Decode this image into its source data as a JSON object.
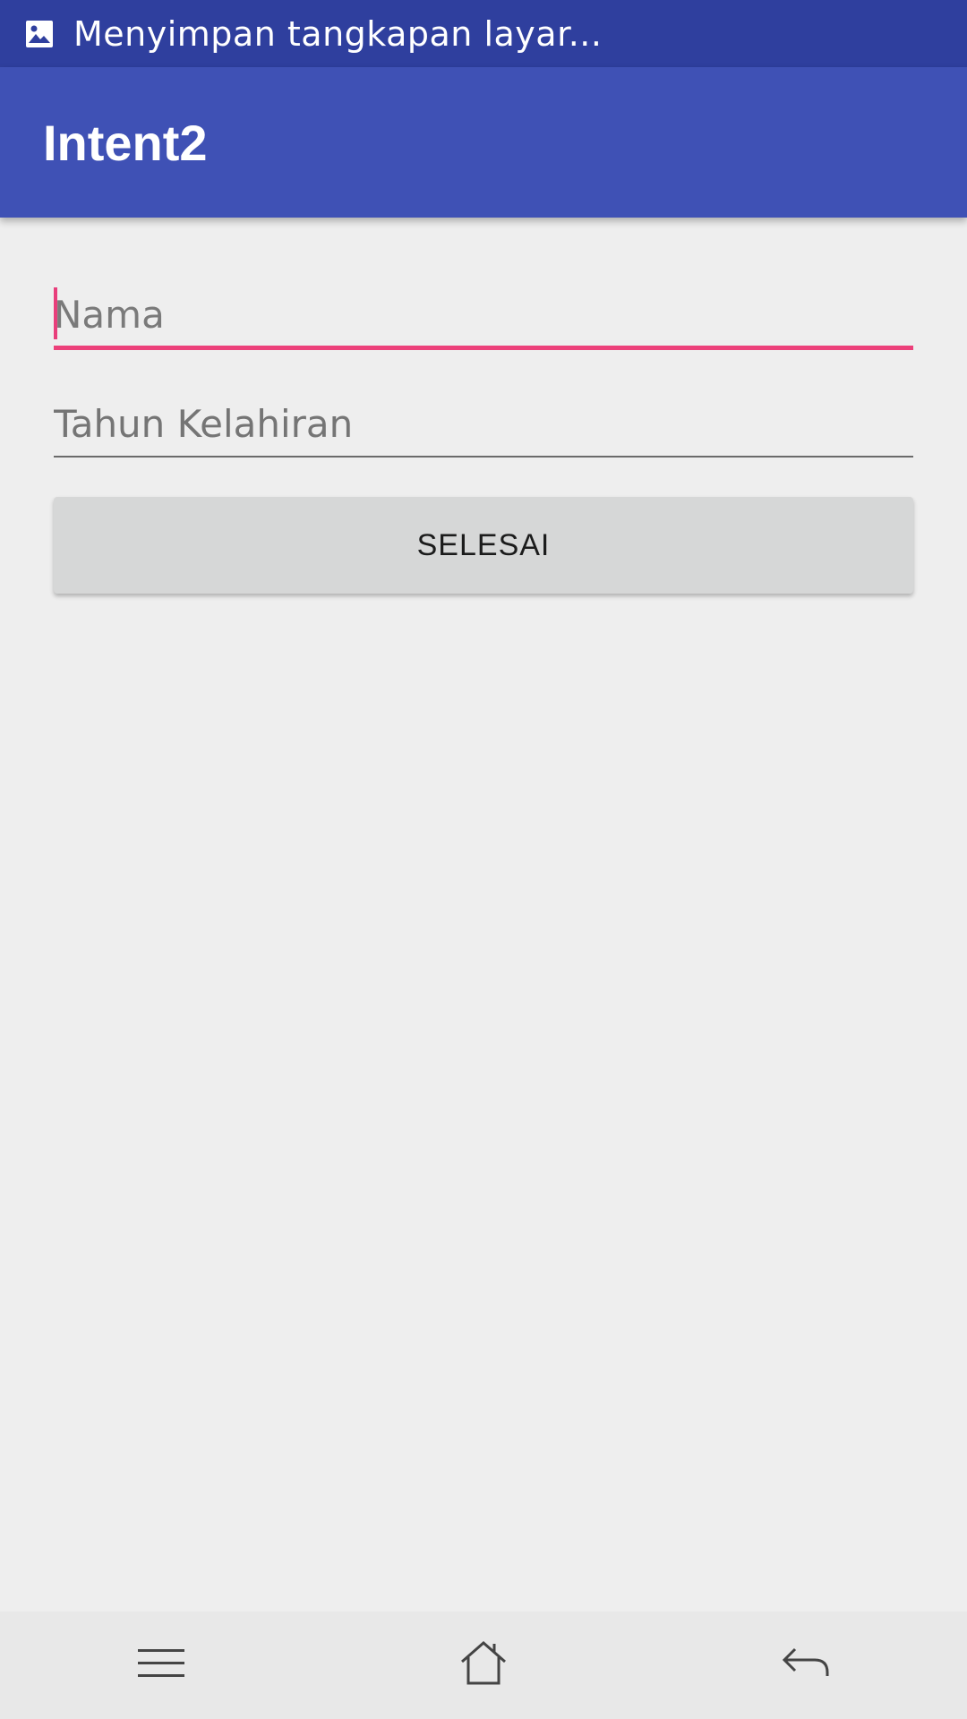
{
  "status_bar": {
    "notification_icon": "image-icon",
    "text": "Menyimpan tangkapan layar..."
  },
  "app_bar": {
    "title": "Intent2"
  },
  "form": {
    "name_placeholder": "Nama",
    "name_value": "",
    "year_placeholder": "Tahun Kelahiran",
    "year_value": "",
    "submit_label": "SELESAI"
  },
  "nav_bar": {
    "menu_icon": "menu-icon",
    "home_icon": "home-icon",
    "back_icon": "back-icon"
  },
  "colors": {
    "status_bar": "#2f3f9e",
    "app_bar": "#3f51b5",
    "accent": "#ec407a",
    "background": "#eeeeee",
    "button": "#d6d7d7"
  }
}
